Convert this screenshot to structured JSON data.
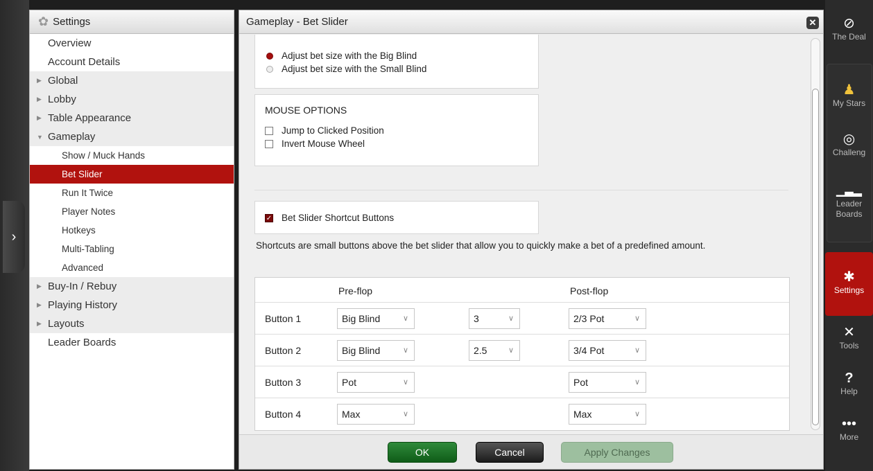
{
  "nav": {
    "title": "Settings",
    "items": [
      {
        "label": "Overview",
        "expandable": false,
        "shaded": false
      },
      {
        "label": "Account Details",
        "expandable": false,
        "shaded": false
      },
      {
        "label": "Global",
        "expandable": true,
        "shaded": true
      },
      {
        "label": "Lobby",
        "expandable": true,
        "shaded": true
      },
      {
        "label": "Table Appearance",
        "expandable": true,
        "shaded": true
      },
      {
        "label": "Gameplay",
        "expandable": true,
        "expanded": true,
        "shaded": true
      }
    ],
    "gameplay_children": [
      "Show / Muck Hands",
      "Bet Slider",
      "Run It Twice",
      "Player Notes",
      "Hotkeys",
      "Multi-Tabling",
      "Advanced"
    ],
    "active_child": "Bet Slider",
    "items_after": [
      {
        "label": "Buy-In / Rebuy",
        "expandable": true,
        "shaded": true
      },
      {
        "label": "Playing History",
        "expandable": true,
        "shaded": true
      },
      {
        "label": "Layouts",
        "expandable": true,
        "shaded": true
      },
      {
        "label": "Leader Boards",
        "expandable": false,
        "shaded": false
      }
    ]
  },
  "main": {
    "title": "Gameplay - Bet Slider",
    "increment": {
      "option1": "Adjust bet size with the Big Blind",
      "option2": "Adjust bet size with the Small Blind",
      "selected": 1
    },
    "mouse": {
      "title": "MOUSE OPTIONS",
      "option1": "Jump to Clicked Position",
      "option2": "Invert Mouse Wheel"
    },
    "shortcut_toggle": "Bet Slider Shortcut Buttons",
    "description": "Shortcuts are small buttons above the bet slider that allow you to quickly make a bet of a predefined amount.",
    "table": {
      "col_preflop": "Pre-flop",
      "col_postflop": "Post-flop",
      "rows": [
        {
          "label": "Button 1",
          "pre": "Big Blind",
          "mult": "3",
          "post": "2/3 Pot"
        },
        {
          "label": "Button 2",
          "pre": "Big Blind",
          "mult": "2.5",
          "post": "3/4 Pot"
        },
        {
          "label": "Button 3",
          "pre": "Pot",
          "mult": null,
          "post": "Pot"
        },
        {
          "label": "Button 4",
          "pre": "Max",
          "mult": null,
          "post": "Max"
        }
      ]
    },
    "buttons": {
      "ok": "OK",
      "cancel": "Cancel",
      "apply": "Apply Changes"
    }
  },
  "toolbar": {
    "deal": "The Deal",
    "my_stars": "My Stars",
    "challenges": "Challeng",
    "leader_1": "Leader",
    "leader_2": "Boards",
    "settings": "Settings",
    "tools": "Tools",
    "help": "Help",
    "more": "More"
  },
  "colors": {
    "accent": "#b1120e",
    "ok_green": "#1f7a2a"
  }
}
